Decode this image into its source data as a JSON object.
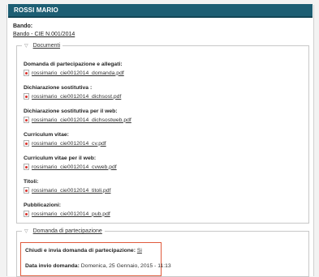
{
  "header": {
    "title": "ROSSI MARIO"
  },
  "bando": {
    "label": "Bando:",
    "link": "Bando - CIE N.001/2014"
  },
  "documenti": {
    "legend": "Documenti",
    "items": [
      {
        "title": "Domanda di partecipazione e allegati:",
        "file": "rossimario_cie0012014_domanda.pdf"
      },
      {
        "title": "Dichiarazione sostitutiva :",
        "file": "rossimario_cie0012014_dichsost.pdf"
      },
      {
        "title": "Dichiarazione sostitutiva per il web:",
        "file": "rossimario_cie0012014_dichsostweb.pdf"
      },
      {
        "title": "Curriculum vitae:",
        "file": "rossimario_cie0012014_cv.pdf"
      },
      {
        "title": "Curriculum vitae per il web:",
        "file": "rossimario_cie0012014_cvweb.pdf"
      },
      {
        "title": "Titoli:",
        "file": "rossimario_cie0012014_titoli.pdf"
      },
      {
        "title": "Pubblicazioni:",
        "file": "rossimario_cie0012014_pub.pdf"
      }
    ]
  },
  "domanda": {
    "legend": "Domanda di partecipazione",
    "chiudi_label": "Chiudi e invia domanda di partecipazione:",
    "chiudi_value": "Si",
    "data_label": "Data invio domanda:",
    "data_value": "Domenica, 25 Gennaio, 2015 - 11:13"
  },
  "colors": {
    "header_bg": "#1d5e73",
    "highlight_border": "#e05a3c",
    "pdf_icon": "#d8302a"
  },
  "icons": [
    "pdf-icon",
    "chevron-down-icon"
  ]
}
